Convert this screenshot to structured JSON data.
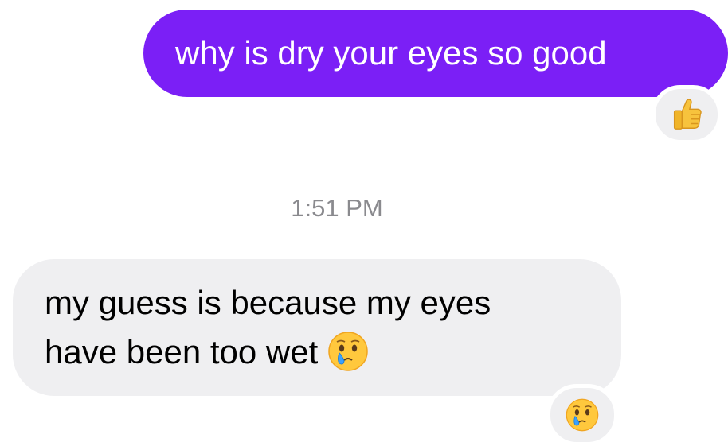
{
  "messages": [
    {
      "direction": "outgoing",
      "text": "why is dry your eyes so good",
      "reaction": "thumbs-up-icon"
    },
    {
      "direction": "incoming",
      "lines": [
        "my guess is because my eyes",
        "have been too wet"
      ],
      "inline_emoji": "face-holding-back-tears-icon",
      "reaction": "face-holding-back-tears-icon"
    }
  ],
  "timestamp": "1:51 PM",
  "colors": {
    "outgoing_bubble": "#7b1ff6",
    "incoming_bubble": "#efeff1",
    "timestamp_text": "#8a8a8e"
  }
}
